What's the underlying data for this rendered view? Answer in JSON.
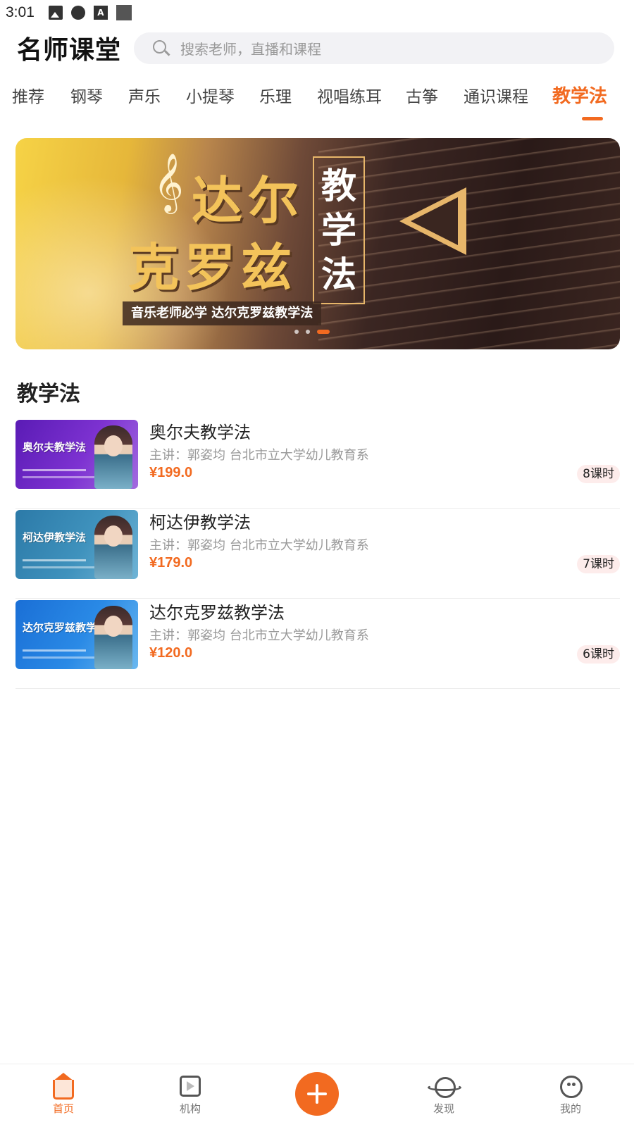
{
  "status_bar": {
    "time": "3:01"
  },
  "header": {
    "title": "名师课堂",
    "search_placeholder": "搜索老师，直播和课程"
  },
  "tabs": [
    {
      "label": "推荐"
    },
    {
      "label": "钢琴"
    },
    {
      "label": "声乐"
    },
    {
      "label": "小提琴"
    },
    {
      "label": "乐理"
    },
    {
      "label": "视唱练耳"
    },
    {
      "label": "古筝"
    },
    {
      "label": "通识课程"
    },
    {
      "label": "教学法",
      "active": true
    }
  ],
  "banner": {
    "title_line1": "达尔",
    "title_line2": "克罗兹",
    "vertical_chars": [
      "教",
      "学",
      "法"
    ],
    "subtitle": "音乐老师必学  达尔克罗兹教学法",
    "page_count": 3,
    "active_index": 2
  },
  "section": {
    "title": "教学法"
  },
  "courses": [
    {
      "thumb_title": "奥尔夫教学法",
      "name": "奥尔夫教学法",
      "teacher": "主讲：郭姿均 台北市立大学幼儿教育系",
      "price": "¥199.0",
      "lessons": "8课时"
    },
    {
      "thumb_title": "柯达伊教学法",
      "name": "柯达伊教学法",
      "teacher": "主讲：郭姿均 台北市立大学幼儿教育系",
      "price": "¥179.0",
      "lessons": "7课时"
    },
    {
      "thumb_title": "达尔克罗兹教学法",
      "name": "达尔克罗兹教学法",
      "teacher": "主讲：郭姿均 台北市立大学幼儿教育系",
      "price": "¥120.0",
      "lessons": "6课时"
    }
  ],
  "bottom_nav": [
    {
      "label": "首页",
      "icon": "home-icon",
      "active": true
    },
    {
      "label": "机构",
      "icon": "video-icon"
    },
    {
      "label": "",
      "icon": "plus-icon"
    },
    {
      "label": "发现",
      "icon": "planet-icon"
    },
    {
      "label": "我的",
      "icon": "face-icon"
    }
  ],
  "colors": {
    "accent": "#f26a20",
    "text": "#222222",
    "muted": "#999999"
  }
}
